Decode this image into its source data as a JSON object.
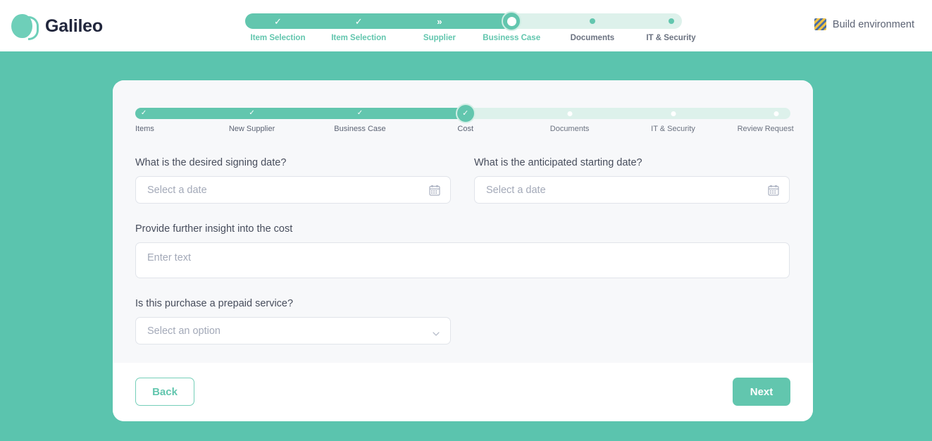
{
  "brand": {
    "name": "Galileo",
    "logo_icon": "galileo-logo-icon",
    "accent_color": "#62c6ae"
  },
  "environment_flag": {
    "label": "Build environment",
    "icon": "striped-warning-icon"
  },
  "top_stepper": {
    "current_index": 3,
    "progress_percent": 61,
    "steps": [
      {
        "label": "Item Selection",
        "state": "done",
        "marker": "check"
      },
      {
        "label": "Item Selection",
        "state": "done",
        "marker": "check"
      },
      {
        "label": "Supplier",
        "state": "done",
        "marker": "chevrons"
      },
      {
        "label": "Business Case",
        "state": "current",
        "marker": "ring"
      },
      {
        "label": "Documents",
        "state": "todo",
        "marker": "dot"
      },
      {
        "label": "IT & Security",
        "state": "todo",
        "marker": "dot"
      }
    ]
  },
  "inner_stepper": {
    "current_index": 3,
    "progress_percent": 50,
    "steps": [
      {
        "label": "Items",
        "state": "done",
        "marker": "check"
      },
      {
        "label": "New Supplier",
        "state": "done",
        "marker": "check"
      },
      {
        "label": "Business Case",
        "state": "done",
        "marker": "check"
      },
      {
        "label": "Cost",
        "state": "current",
        "marker": "check-ring"
      },
      {
        "label": "Documents",
        "state": "todo",
        "marker": "dot"
      },
      {
        "label": "IT & Security",
        "state": "todo",
        "marker": "dot"
      },
      {
        "label": "Review Request",
        "state": "todo",
        "marker": "dot"
      }
    ]
  },
  "form": {
    "signing_date": {
      "label": "What is the desired signing date?",
      "placeholder": "Select a date",
      "value": "",
      "icon": "calendar-icon"
    },
    "starting_date": {
      "label": "What is the anticipated starting date?",
      "placeholder": "Select a date",
      "value": "",
      "icon": "calendar-icon"
    },
    "cost_insight": {
      "label": "Provide further insight into the cost",
      "placeholder": "Enter text",
      "value": ""
    },
    "prepaid_service": {
      "label": "Is this purchase a prepaid service?",
      "placeholder": "Select an option",
      "value": "",
      "icon": "chevron-down-icon"
    }
  },
  "footer": {
    "back_label": "Back",
    "next_label": "Next"
  }
}
